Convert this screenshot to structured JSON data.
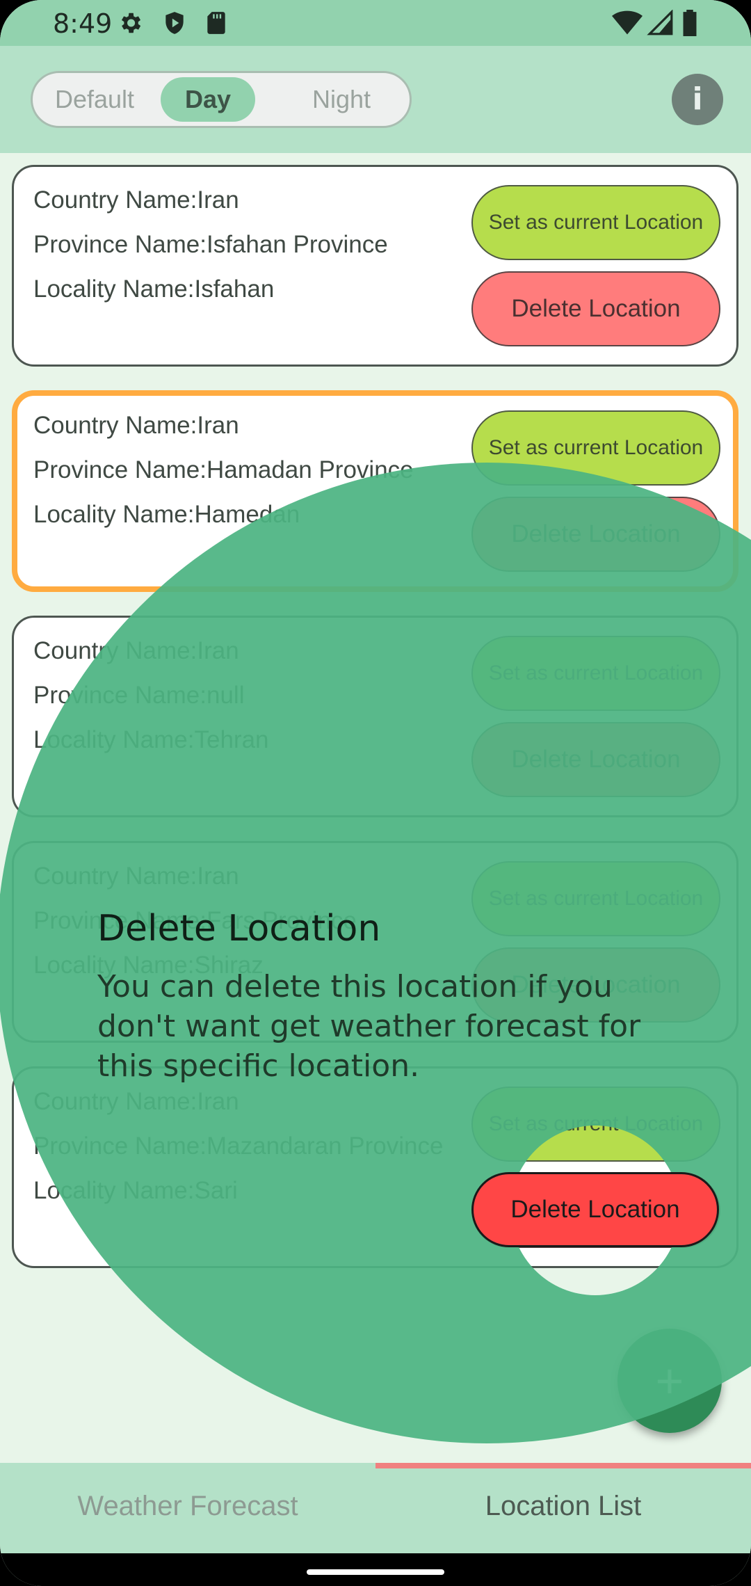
{
  "status_bar": {
    "time": "8:49"
  },
  "theme_selector": {
    "options": [
      "Default",
      "Day",
      "Night"
    ],
    "selected": "Day"
  },
  "info_button": {
    "label": "i"
  },
  "locations": [
    {
      "country": "Country Name:Iran",
      "province": "Province Name:Isfahan Province",
      "locality": "Locality Name:Isfahan",
      "selected": false
    },
    {
      "country": "Country Name:Iran",
      "province": "Province Name:Hamadan Province",
      "locality": "Locality Name:Hamedan",
      "selected": true
    },
    {
      "country": "Country Name:Iran",
      "province": "Province Name:null",
      "locality": "Locality Name:Tehran",
      "selected": false
    },
    {
      "country": "Country Name:Iran",
      "province": "Province Name:Fars Province",
      "locality": "Locality Name:Shiraz",
      "selected": false
    },
    {
      "country": "Country Name:Iran",
      "province": "Province Name:Mazandaran Province",
      "locality": "Locality Name:Sari",
      "selected": false
    }
  ],
  "card_buttons": {
    "set_current": "Set as current Location",
    "delete": "Delete Location"
  },
  "fab": {
    "label": "+"
  },
  "bottom_nav": {
    "tabs": [
      "Weather Forecast",
      "Location List"
    ],
    "active": "Location List"
  },
  "showcase": {
    "title": "Delete Location",
    "description": "You can delete this location if you don't want get weather forecast for this specific location.",
    "target_label": "Delete Location"
  },
  "colors": {
    "status_bar": "#92d2ae",
    "app_bar": "#b4e1c8",
    "background": "#e8f5e9",
    "set_button": "#b6dd4c",
    "delete_button": "#ff7c7c",
    "selected_border": "#ffab40",
    "overlay": "#4cb482",
    "tab_indicator": "#f08080"
  }
}
